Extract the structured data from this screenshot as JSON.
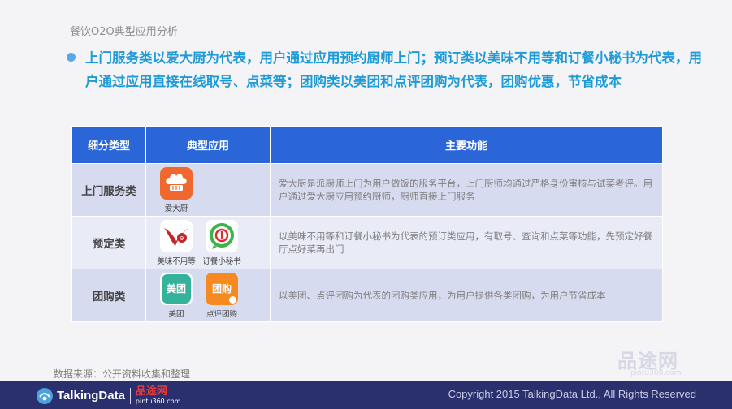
{
  "slide": {
    "title": "餐饮O2O典型应用分析",
    "headline": "上门服务类以爱大厨为代表，用户通过应用预约厨师上门；预订类以美味不用等和订餐小秘书为代表，用户通过应用直接在线取号、点菜等；团购类以美团和点评团购为代表，团购优惠，节省成本"
  },
  "table": {
    "headers": [
      "细分类型",
      "典型应用",
      "主要功能"
    ],
    "rows": [
      {
        "category": "上门服务类",
        "apps": [
          {
            "name": "爱大厨",
            "icon": "chef-hat-icon"
          }
        ],
        "function": "爱大厨是派厨师上门为用户做饭的服务平台，上门厨师均通过严格身份审核与试菜考评。用户通过爱大厨应用预约厨师，厨师直接上门服务"
      },
      {
        "category": "预定类",
        "apps": [
          {
            "name": "美味不用等",
            "icon": "meiwei-logo-icon"
          },
          {
            "name": "订餐小秘书",
            "icon": "dingcan-logo-icon"
          }
        ],
        "function": "以美味不用等和订餐小秘书为代表的预订类应用，有取号、查询和点菜等功能，先预定好餐厅点好菜再出门"
      },
      {
        "category": "团购类",
        "apps": [
          {
            "name": "美团",
            "icon": "meituan-logo-icon",
            "icon_text": "美团"
          },
          {
            "name": "点评团购",
            "icon": "dianping-logo-icon",
            "icon_text": "团购"
          }
        ],
        "function": "以美团、点评团购为代表的团购类应用，为用户提供各类团购，为用户节省成本"
      }
    ]
  },
  "source": "数据来源：公开资料收集和整理",
  "footer": {
    "brand": "TalkingData",
    "partner_name": "品途网",
    "partner_url": "pintu360.com",
    "copyright": "Copyright 2015 TalkingData Ltd., All Rights Reserved"
  },
  "watermark": {
    "text": "品途网",
    "url": "pintu360.com"
  },
  "colors": {
    "header_bg": "#2a66d8",
    "headline": "#1e9ad6",
    "footer_bg": "#2a2f6e",
    "row_odd": "#d7dbf0",
    "row_even": "#e9ebf6"
  }
}
